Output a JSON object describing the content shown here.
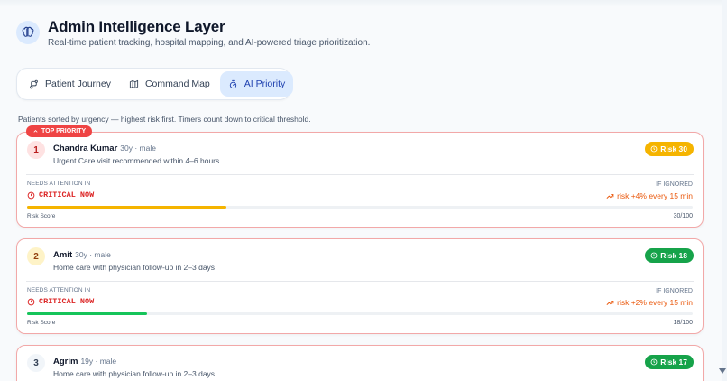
{
  "header": {
    "icon": "brain-icon",
    "title": "Admin Intelligence Layer",
    "subtitle": "Real-time patient tracking, hospital mapping, and AI-powered triage prioritization."
  },
  "tabs": [
    {
      "label": "Patient Journey",
      "icon": "route-icon",
      "active": false
    },
    {
      "label": "Command Map",
      "icon": "map-icon",
      "active": false
    },
    {
      "label": "AI Priority",
      "icon": "timer-icon",
      "active": true
    }
  ],
  "hint": "Patients sorted by urgency — highest risk first. Timers count down to critical threshold.",
  "labels": {
    "top_priority": "TOP PRIORITY",
    "needs_attention": "NEEDS ATTENTION IN",
    "if_ignored": "IF IGNORED",
    "risk_score": "Risk Score"
  },
  "patients": [
    {
      "rank": "1",
      "name": "Chandra Kumar",
      "meta": "30y · male",
      "recommendation": "Urgent Care visit recommended within 4–6 hours",
      "risk_label": "Risk 30",
      "critical": "CRITICAL NOW",
      "trend": "risk +4% every 15 min",
      "score": "30/100",
      "score_fraction": 0.3,
      "pill_color": "#f5b400",
      "bar_color": "#f5b400",
      "rank_bg": "#fee2e2",
      "rank_color": "#b91c1c"
    },
    {
      "rank": "2",
      "name": "Amit",
      "meta": "30y · male",
      "recommendation": "Home care with physician follow-up in 2–3 days",
      "risk_label": "Risk 18",
      "critical": "CRITICAL NOW",
      "trend": "risk +2% every 15 min",
      "score": "18/100",
      "score_fraction": 0.18,
      "pill_color": "#16a34a",
      "bar_color": "#16c45a",
      "rank_bg": "#fef3c7",
      "rank_color": "#92400e"
    },
    {
      "rank": "3",
      "name": "Agrim",
      "meta": "19y · male",
      "recommendation": "Home care with physician follow-up in 2–3 days",
      "risk_label": "Risk 17",
      "pill_color": "#16a34a",
      "rank_bg": "#f1f5f9",
      "rank_color": "#334155"
    }
  ]
}
